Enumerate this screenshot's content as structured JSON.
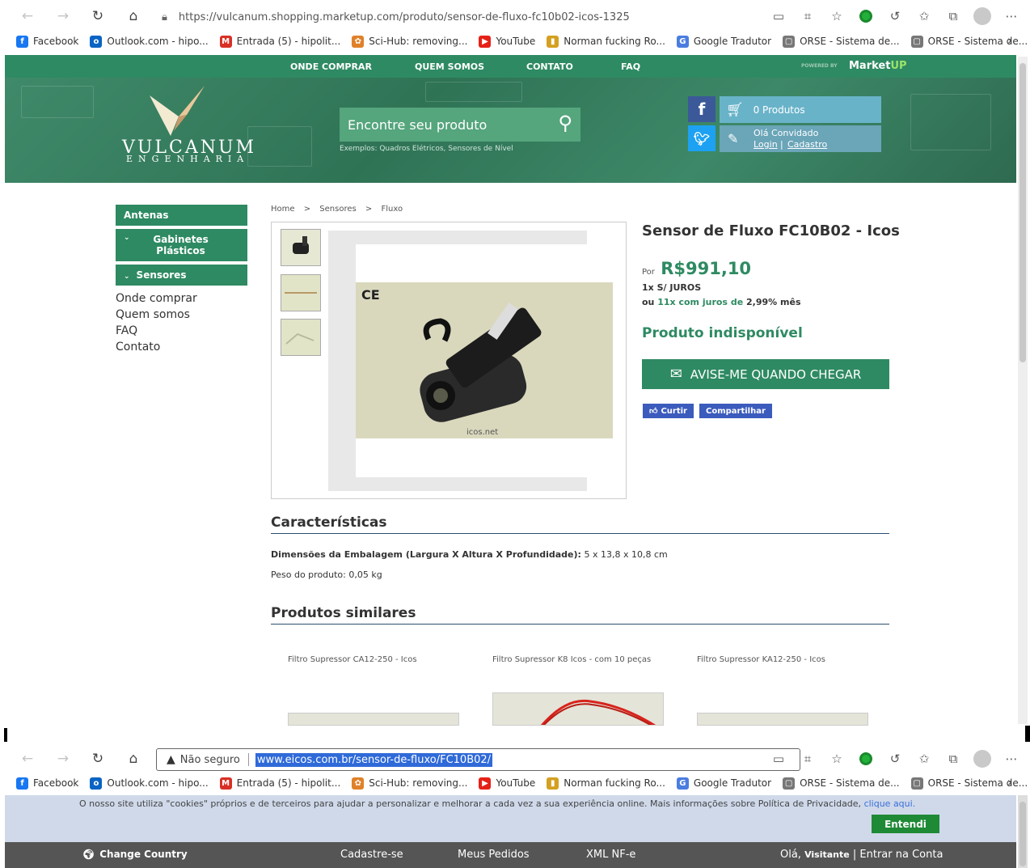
{
  "window1": {
    "url": "https://vulcanum.shopping.marketup.com/produto/sensor-de-fluxo-fc10b02-icos-1325",
    "bookmarks": [
      {
        "label": "Facebook",
        "icon": "facebook-icon",
        "color": "#1877f2",
        "glyph": "f"
      },
      {
        "label": "Outlook.com - hipo...",
        "icon": "outlook-icon",
        "color": "#0a64c4",
        "glyph": "o"
      },
      {
        "label": "Entrada (5) - hipolit...",
        "icon": "gmail-icon",
        "color": "#d93025",
        "glyph": "M"
      },
      {
        "label": "Sci-Hub: removing...",
        "icon": "scihub-icon",
        "color": "#e0812a",
        "glyph": "✿"
      },
      {
        "label": "YouTube",
        "icon": "youtube-icon",
        "color": "#e62117",
        "glyph": "▶"
      },
      {
        "label": "Norman fucking Ro...",
        "icon": "chart-icon",
        "color": "#d4a020",
        "glyph": "▮"
      },
      {
        "label": "Google Tradutor",
        "icon": "translate-icon",
        "color": "#4a7de0",
        "glyph": "G"
      },
      {
        "label": "ORSE - Sistema de...",
        "icon": "page-icon",
        "color": "#777777",
        "glyph": "▢"
      },
      {
        "label": "ORSE - Sistema de...",
        "icon": "page-icon",
        "color": "#777777",
        "glyph": "▢"
      }
    ],
    "site": {
      "nav": [
        "ONDE COMPRAR",
        "QUEM SOMOS",
        "CONTATO",
        "FAQ"
      ],
      "powered_by": "POWERED BY",
      "brand": "Market",
      "brand_suffix": "UP",
      "logo_title": "VULCANUM",
      "logo_sub": "ENGENHARIA",
      "search_placeholder": "Encontre seu produto",
      "search_examples": "Exemplos: Quadros Elétricos, Sensores de Nível",
      "cart_label": "0 Produtos",
      "greeting": "Olá Convidado",
      "login": "Login",
      "separator": "|",
      "register": "Cadastro"
    },
    "sidebar": {
      "categories": [
        "Antenas",
        "Gabinetes Plásticos",
        "Sensores"
      ],
      "links": [
        "Onde comprar",
        "Quem somos",
        "FAQ",
        "Contato"
      ]
    },
    "breadcrumb": [
      "Home",
      "Sensores",
      "Fluxo"
    ],
    "breadcrumb_sep": ">",
    "product": {
      "title": "Sensor de Fluxo FC10B02 - Icos",
      "price_prefix": "Por",
      "price": "R$991,10",
      "installment1": "1x S/ JUROS",
      "installment2_prefix": "ou",
      "installment2_num": "11x",
      "installment2_mid": "com juros de",
      "installment2_rate": "2,99%",
      "installment2_suffix": "mês",
      "status": "Produto indisponível",
      "notify_button": "AVISE-ME QUANDO CHEGAR",
      "like_button": "Curtir",
      "share_button": "Compartilhar",
      "image_ce": "CE",
      "image_caption": "icos.net"
    },
    "features": {
      "heading": "Características",
      "dimensions_label": "Dimensões da Embalagem (Largura X Altura X Profundidade):",
      "dimensions_value": "5 x 13,8 x 10,8 cm",
      "weight_label": "Peso do produto:",
      "weight_value": "0,05 kg"
    },
    "similar": {
      "heading": "Produtos similares",
      "items": [
        "Filtro Supressor CA12-250 - Icos",
        "Filtro Supressor K8 Icos - com 10 peças",
        "Filtro Supressor KA12-250 - Icos"
      ]
    }
  },
  "window2": {
    "security": "Não seguro",
    "url": "www.eicos.com.br/sensor-de-fluxo/FC10B02/",
    "cookie_text": "O nosso site utiliza \"cookies\" próprios e de terceiros para ajudar a personalizar e melhorar a cada vez a sua experiência online. Mais informações sobre Política de Privacidade,",
    "cookie_link": "clique aqui.",
    "accept": "Entendi",
    "bar": {
      "country": "Change Country",
      "register": "Cadastre-se",
      "orders": "Meus Pedidos",
      "xml": "XML NF-e",
      "hello": "Olá,",
      "visitor": "Visitante",
      "sep": "|",
      "login": "Entrar na Conta"
    }
  }
}
